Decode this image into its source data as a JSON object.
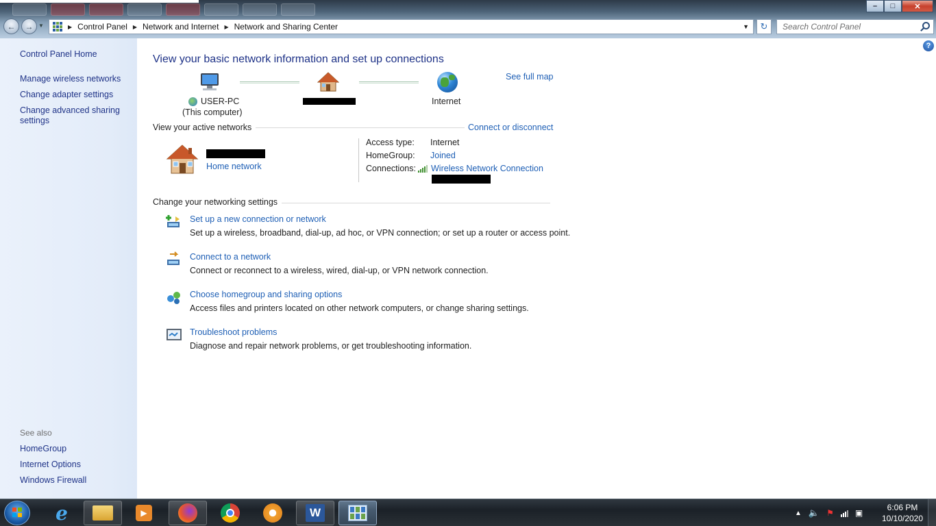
{
  "window": {
    "controls": {
      "minimize": "–",
      "maximize": "□",
      "close": "✕"
    }
  },
  "nav": {
    "back_icon": "←",
    "forward_icon": "→",
    "breadcrumbs": [
      "Control Panel",
      "Network and Internet",
      "Network and Sharing Center"
    ],
    "refresh_icon": "↻",
    "search_placeholder": "Search Control Panel"
  },
  "sidebar": {
    "home": "Control Panel Home",
    "links": [
      "Manage wireless networks",
      "Change adapter settings",
      "Change advanced sharing settings"
    ],
    "see_also_title": "See also",
    "see_also": [
      "HomeGroup",
      "Internet Options",
      "Windows Firewall"
    ]
  },
  "main": {
    "help_icon": "?",
    "title": "View your basic network information and set up connections",
    "see_full_map": "See full map",
    "map": {
      "computer_name": "USER-PC",
      "computer_sub": "(This computer)",
      "internet_label": "Internet"
    },
    "active_networks": {
      "heading": "View your active networks",
      "connect_link": "Connect or disconnect",
      "network_type": "Home network",
      "access_type_label": "Access type:",
      "access_type_value": "Internet",
      "homegroup_label": "HomeGroup:",
      "homegroup_value": "Joined",
      "connections_label": "Connections:",
      "connections_value": "Wireless Network Connection"
    },
    "settings": {
      "heading": "Change your networking settings",
      "tasks": [
        {
          "title": "Set up a new connection or network",
          "desc": "Set up a wireless, broadband, dial-up, ad hoc, or VPN connection; or set up a router or access point."
        },
        {
          "title": "Connect to a network",
          "desc": "Connect or reconnect to a wireless, wired, dial-up, or VPN network connection."
        },
        {
          "title": "Choose homegroup and sharing options",
          "desc": "Access files and printers located on other network computers, or change sharing settings."
        },
        {
          "title": "Troubleshoot problems",
          "desc": "Diagnose and repair network problems, or get troubleshooting information."
        }
      ]
    }
  },
  "taskbar": {
    "icons": [
      "start-orb",
      "internet-explorer-icon",
      "file-explorer-icon",
      "media-player-icon",
      "firefox-icon",
      "chrome-icon",
      "settings-app-icon",
      "word-icon",
      "control-panel-icon"
    ],
    "clock_time": "6:06 PM",
    "clock_date": "10/10/2020"
  }
}
